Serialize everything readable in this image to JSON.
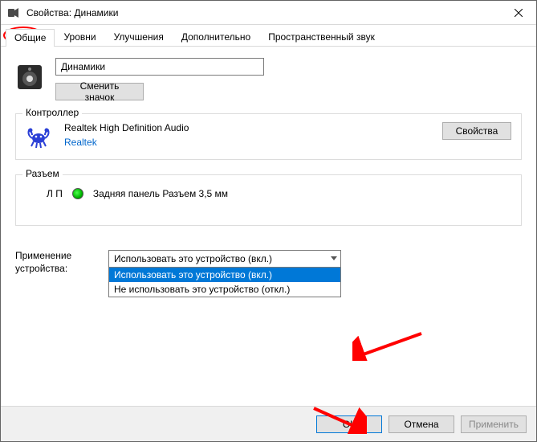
{
  "window": {
    "title": "Свойства: Динамики"
  },
  "tabs": [
    {
      "label": "Общие",
      "active": true
    },
    {
      "label": "Уровни"
    },
    {
      "label": "Улучшения"
    },
    {
      "label": "Дополнительно"
    },
    {
      "label": "Пространственный звук"
    }
  ],
  "device": {
    "name_value": "Динамики",
    "change_icon_label": "Сменить значок"
  },
  "controller": {
    "group_label": "Контроллер",
    "name": "Realtek High Definition Audio",
    "vendor": "Realtek",
    "properties_label": "Свойства"
  },
  "jack": {
    "group_label": "Разъем",
    "channel": "Л П",
    "description": "Задняя панель Разъем 3,5 мм"
  },
  "usage": {
    "label": "Применение устройства:",
    "selected": "Использовать это устройство (вкл.)",
    "options": [
      "Использовать это устройство (вкл.)",
      "Не использовать это устройство (откл.)"
    ]
  },
  "footer": {
    "ok": "ОК",
    "cancel": "Отмена",
    "apply": "Применить"
  }
}
